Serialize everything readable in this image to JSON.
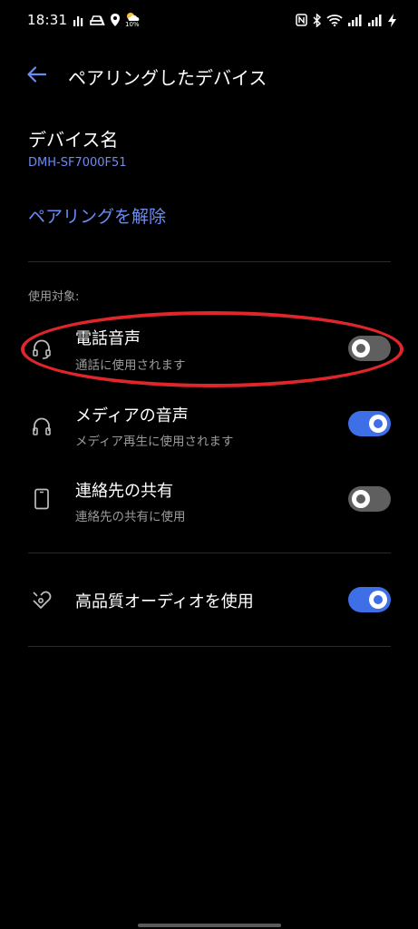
{
  "status_bar": {
    "time": "18:31",
    "weather_text": "10%",
    "left_icons": [
      "signal-bars-icon",
      "car-icon",
      "location-icon",
      "weather-icon"
    ],
    "right_icons": [
      "nfc-icon",
      "bluetooth-icon",
      "wifi-icon",
      "cell-signal-icon",
      "cell-signal-icon",
      "charging-icon"
    ]
  },
  "app_bar": {
    "title": "ペアリングしたデバイス",
    "back_icon": "arrow-back-icon"
  },
  "device": {
    "label": "デバイス名",
    "name": "DMH-SF7000F51"
  },
  "unpair_label": "ペアリングを解除",
  "section_label": "使用対象:",
  "profiles": [
    {
      "icon": "headset-mic-icon",
      "title": "電話音声",
      "subtitle": "通話に使用されます",
      "enabled": false
    },
    {
      "icon": "headphones-icon",
      "title": "メディアの音声",
      "subtitle": "メディア再生に使用されます",
      "enabled": true
    },
    {
      "icon": "phone-contacts-icon",
      "title": "連絡先の共有",
      "subtitle": "連絡先の共有に使用",
      "enabled": false
    }
  ],
  "hd_audio": {
    "icon": "hd-audio-icon",
    "title": "高品質オーディオを使用",
    "enabled": true
  },
  "colors": {
    "accent": "#3f6fe6",
    "link": "#6b8bf5",
    "highlight": "#e0262b",
    "toggle_off": "#5f5f5f"
  }
}
